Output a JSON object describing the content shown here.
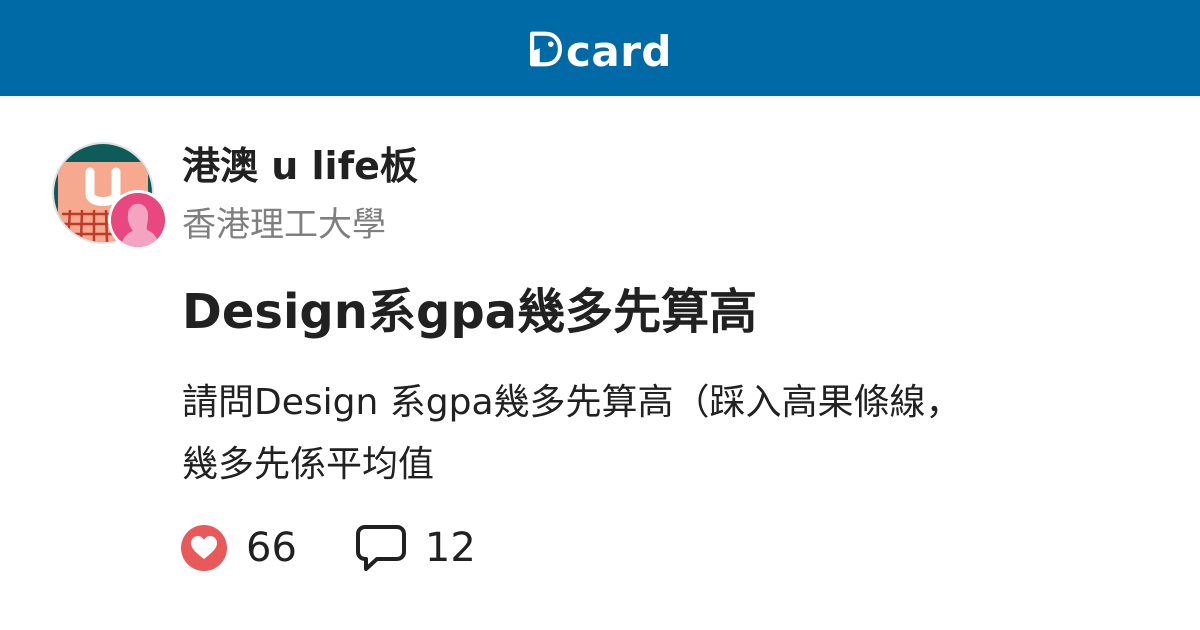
{
  "brand": {
    "logo_text": "card",
    "bar_color": "#006aa6"
  },
  "forum": {
    "name": "港澳 u life板",
    "school": "香港理工大學",
    "avatar_icon": "forum-u-icon",
    "school_avatar_icon": "female-silhouette-icon",
    "school_avatar_color": "#e9477f"
  },
  "post": {
    "title": "Design系gpa幾多先算高",
    "excerpt_lines": [
      "請問Design 系gpa幾多先算高（踩入高果條線，",
      "幾多先係平均值"
    ]
  },
  "stats": {
    "likes": "66",
    "like_icon": "heart-icon",
    "like_color": "#e85a5a",
    "comments": "12",
    "comment_icon": "comment-bubble-icon"
  }
}
